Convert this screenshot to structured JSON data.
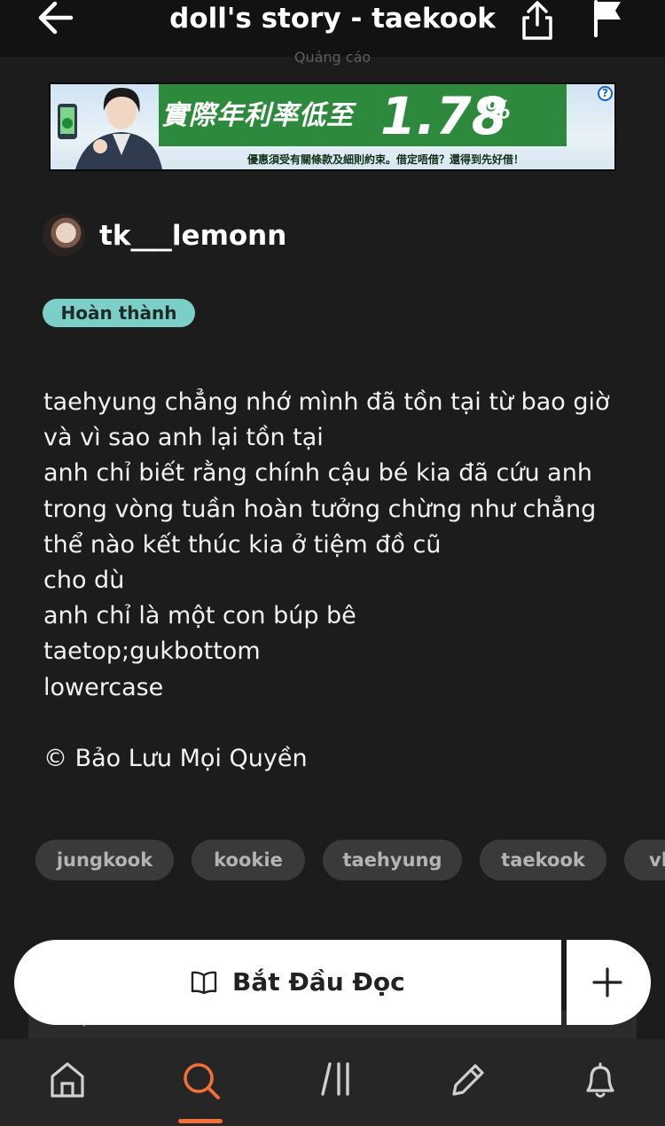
{
  "header": {
    "title": "doll's story - taekook",
    "ad_label": "Quảng cáo"
  },
  "ad": {
    "headline": "實際年利率低至",
    "rate": "1.78",
    "rate_unit": "%",
    "fine_print": "優惠須受有關條款及細則約束。借定唔借？還得到先好借！",
    "help": "?"
  },
  "author": {
    "name": "tk___lemonn"
  },
  "status_badge": "Hoàn thành",
  "description": {
    "lines": [
      "taehyung chẳng nhớ mình đã tồn tại từ bao giờ",
      "và vì sao anh lại tồn tại",
      "anh chỉ biết rằng chính cậu bé kia đã cứu anh",
      "trong vòng tuần hoàn tưởng chừng như chẳng",
      "thể nào kết thúc kia ở tiệm đồ cũ",
      "cho dù",
      "anh chỉ là một con búp bê",
      "taetop;gukbottom",
      "lowercase"
    ],
    "copyright": "© Bảo Lưu Mọi Quyền"
  },
  "tags": [
    "jungkook",
    "kookie",
    "taehyung",
    "taekook",
    "vk"
  ],
  "actions": {
    "start_reading": "Bắt Đầu Đọc"
  },
  "colors": {
    "background": "#1c1c1c",
    "accent": "#f26f3a",
    "badge": "#7ccfc6"
  }
}
